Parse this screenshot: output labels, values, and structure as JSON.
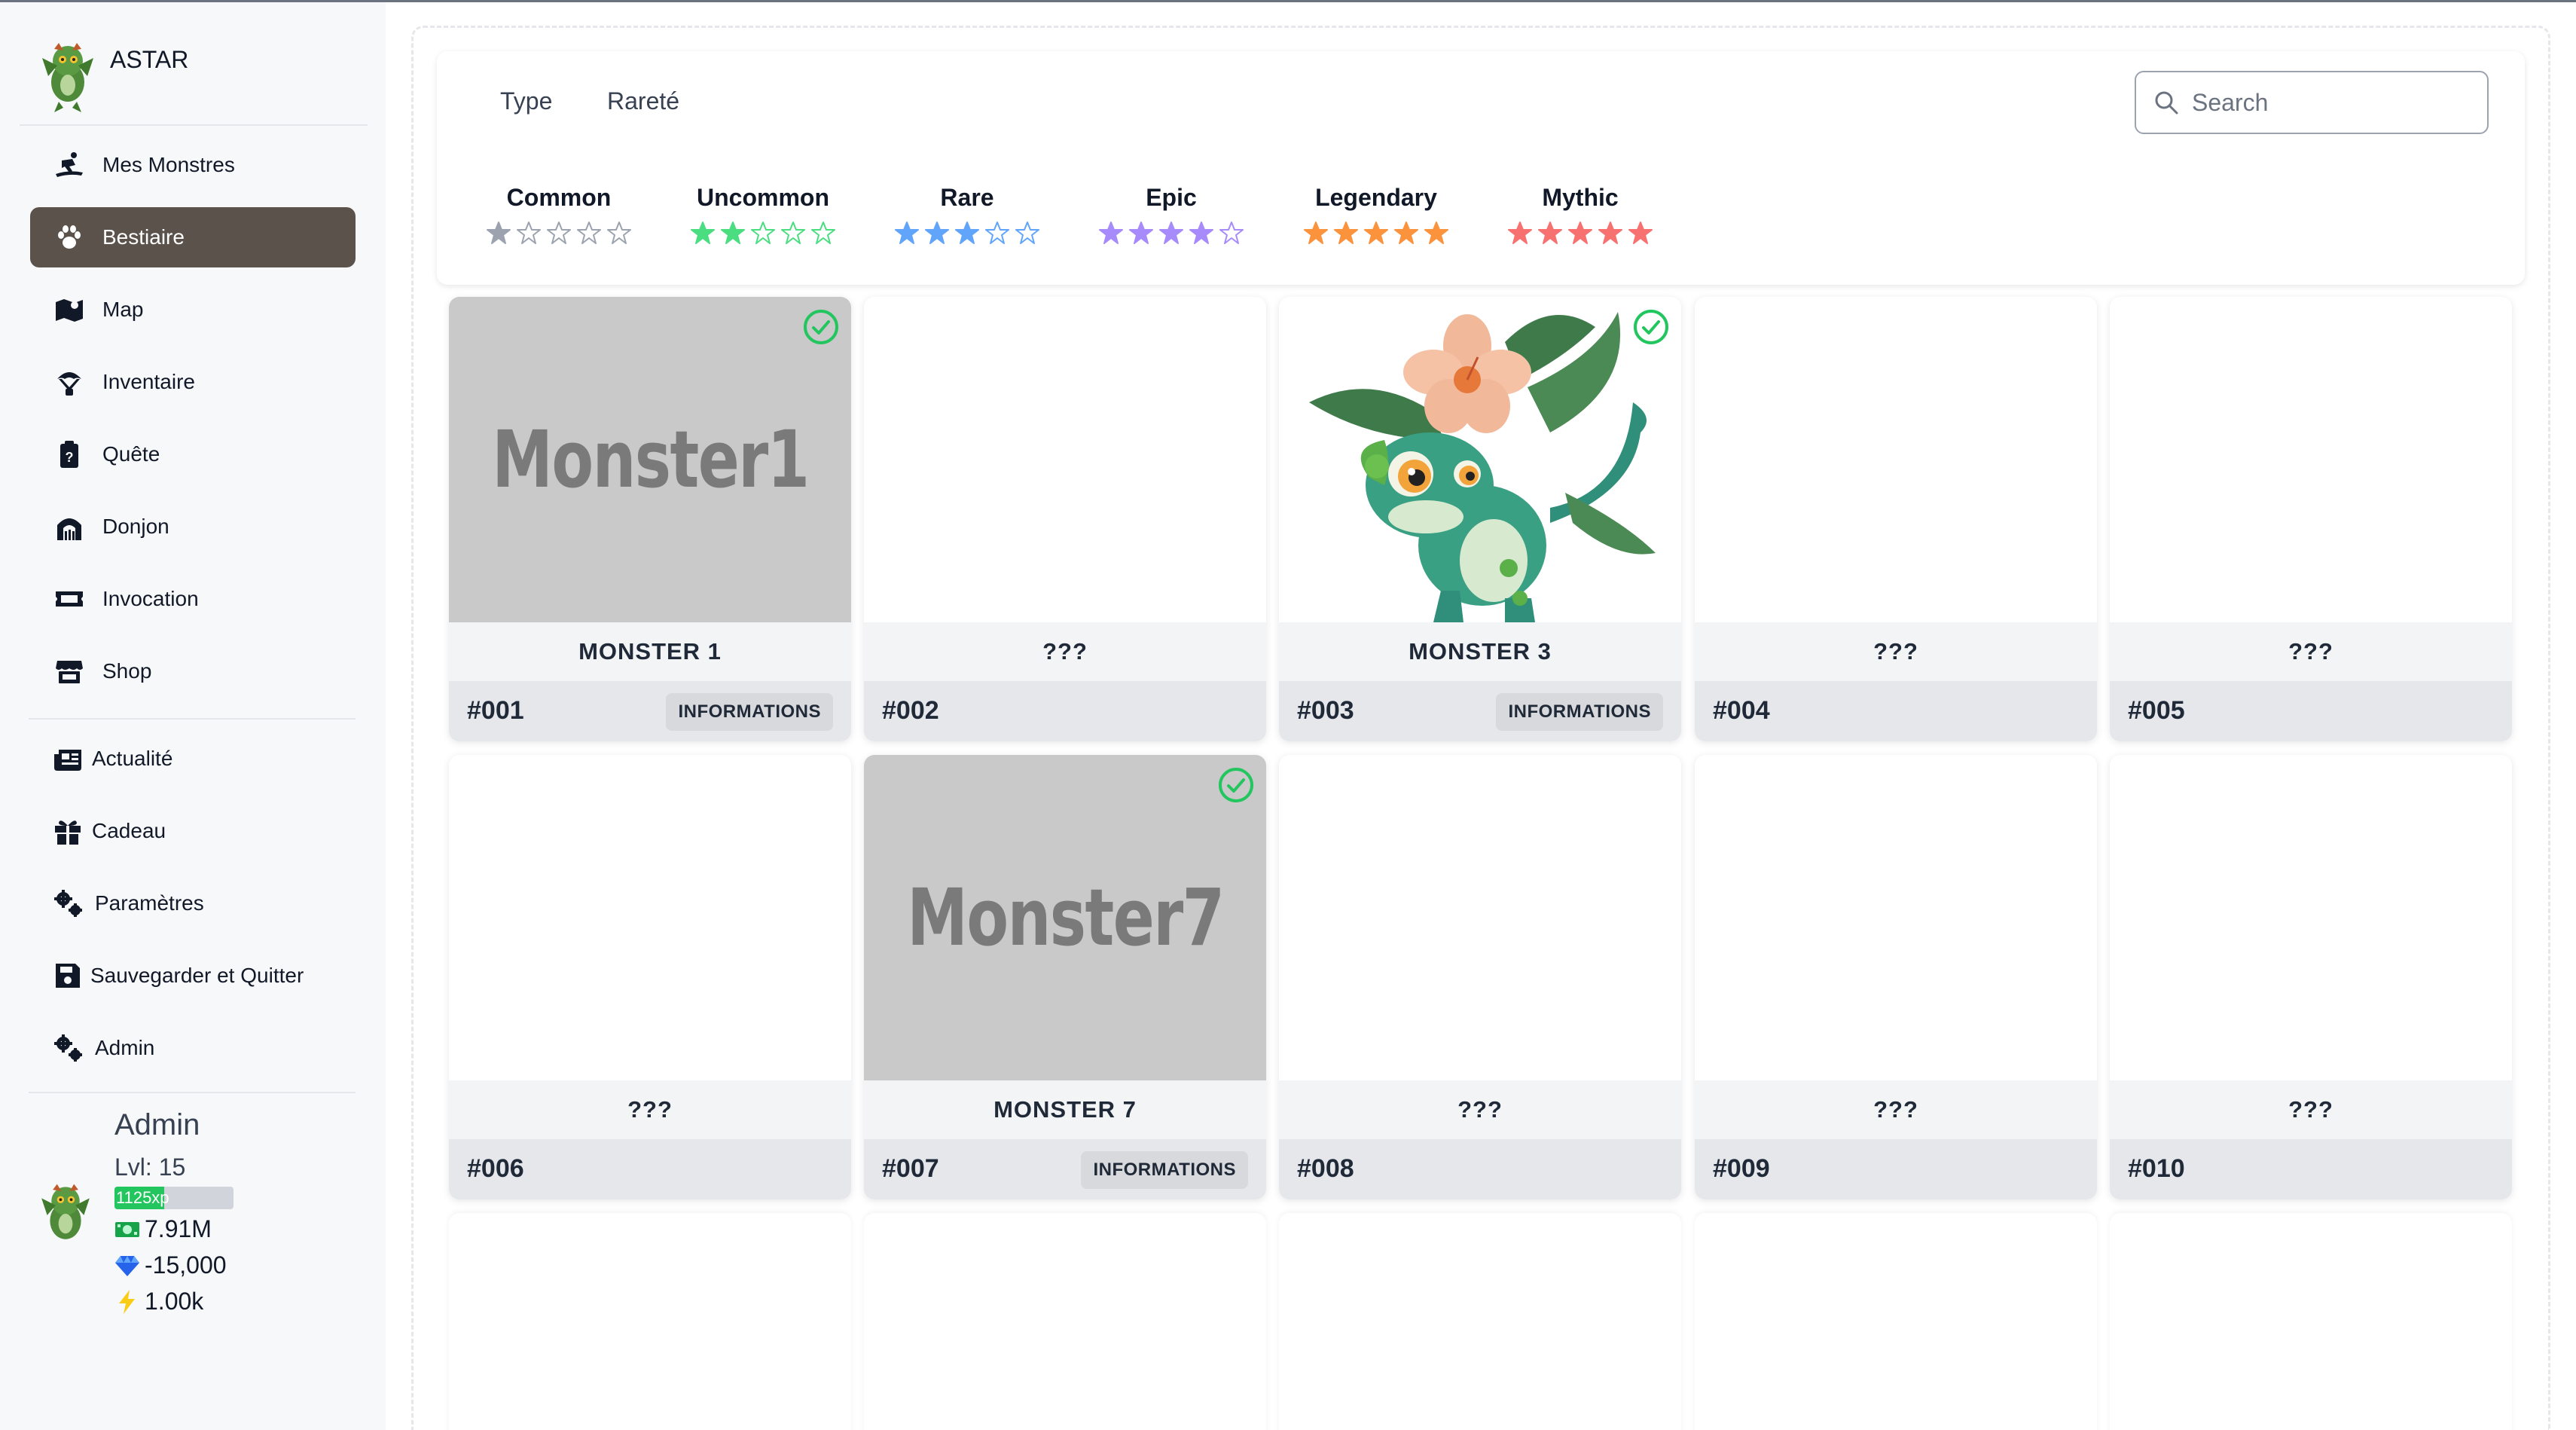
{
  "app": {
    "name": "ASTAR"
  },
  "nav": {
    "items": [
      {
        "label": "Mes Monstres",
        "icon": "surfer-icon"
      },
      {
        "label": "Bestiaire",
        "icon": "paw-icon",
        "active": true
      },
      {
        "label": "Map",
        "icon": "map-icon"
      },
      {
        "label": "Inventaire",
        "icon": "parachute-icon"
      },
      {
        "label": "Quête",
        "icon": "clipboard-icon"
      },
      {
        "label": "Donjon",
        "icon": "dungeon-icon"
      },
      {
        "label": "Invocation",
        "icon": "ticket-icon"
      },
      {
        "label": "Shop",
        "icon": "store-icon"
      }
    ],
    "secondary": [
      {
        "label": "Actualité",
        "icon": "newspaper-icon"
      },
      {
        "label": "Cadeau",
        "icon": "gift-icon"
      },
      {
        "label": "Paramètres",
        "icon": "gears-icon"
      },
      {
        "label": "Sauvegarder et Quitter",
        "icon": "floppy-icon"
      },
      {
        "label": "Admin",
        "icon": "gears-icon"
      }
    ]
  },
  "user": {
    "name": "Admin",
    "level": "Lvl: 15",
    "xp": "1125xp",
    "xp_fraction": 0.42,
    "money": "7.91M",
    "gems": "-15,000",
    "energy": "1.00k"
  },
  "filters": {
    "tabs": [
      "Type",
      "Rareté"
    ],
    "search_placeholder": "Search",
    "rarities": [
      {
        "name": "Common",
        "filled": 1,
        "color": "#9ca3af"
      },
      {
        "name": "Uncommon",
        "filled": 2,
        "color": "#4ade80"
      },
      {
        "name": "Rare",
        "filled": 3,
        "color": "#60a5fa"
      },
      {
        "name": "Epic",
        "filled": 4,
        "color": "#a78bfa"
      },
      {
        "name": "Legendary",
        "filled": 5,
        "color": "#fb923c"
      },
      {
        "name": "Mythic",
        "filled": 5,
        "color": "#f87171"
      }
    ]
  },
  "monsters": [
    {
      "number": "#001",
      "name": "MONSTER 1",
      "image": "placeholder",
      "image_text": "Monster1",
      "owned": true,
      "info": "INFORMATIONS"
    },
    {
      "number": "#002",
      "name": "???",
      "image": "none",
      "owned": false
    },
    {
      "number": "#003",
      "name": "MONSTER 3",
      "image": "creature",
      "owned": true,
      "info": "INFORMATIONS"
    },
    {
      "number": "#004",
      "name": "???",
      "image": "none",
      "owned": false
    },
    {
      "number": "#005",
      "name": "???",
      "image": "none",
      "owned": false
    },
    {
      "number": "#006",
      "name": "???",
      "image": "none",
      "owned": false
    },
    {
      "number": "#007",
      "name": "MONSTER 7",
      "image": "placeholder",
      "image_text": "Monster7",
      "owned": true,
      "info": "INFORMATIONS"
    },
    {
      "number": "#008",
      "name": "???",
      "image": "none",
      "owned": false
    },
    {
      "number": "#009",
      "name": "???",
      "image": "none",
      "owned": false
    },
    {
      "number": "#010",
      "name": "???",
      "image": "none",
      "owned": false
    }
  ],
  "colors": {
    "accent_active": "#5a524b",
    "check": "#22c55e"
  }
}
